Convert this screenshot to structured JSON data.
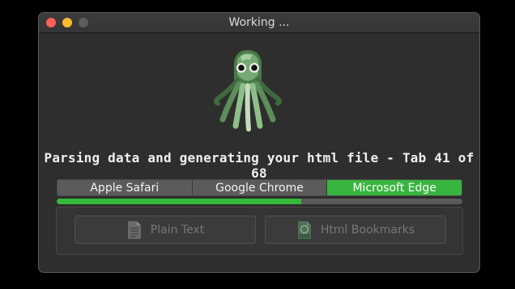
{
  "window": {
    "title": "Working ..."
  },
  "status_text": "Parsing data and generating your html file - Tab 41 of 68",
  "browser_tabs": [
    {
      "label": "Apple Safari",
      "selected": false
    },
    {
      "label": "Google Chrome",
      "selected": false
    },
    {
      "label": "Microsoft Edge",
      "selected": true
    }
  ],
  "progress": {
    "fraction": 0.603
  },
  "export_buttons": {
    "plain_text": {
      "label": "Plain Text",
      "icon": "text-file-icon",
      "enabled": false
    },
    "html_bookmarks": {
      "label": "Html Bookmarks",
      "icon": "html-file-icon",
      "enabled": false
    }
  },
  "colors": {
    "accent": "#38b53e",
    "background": "#2e2e2e"
  }
}
